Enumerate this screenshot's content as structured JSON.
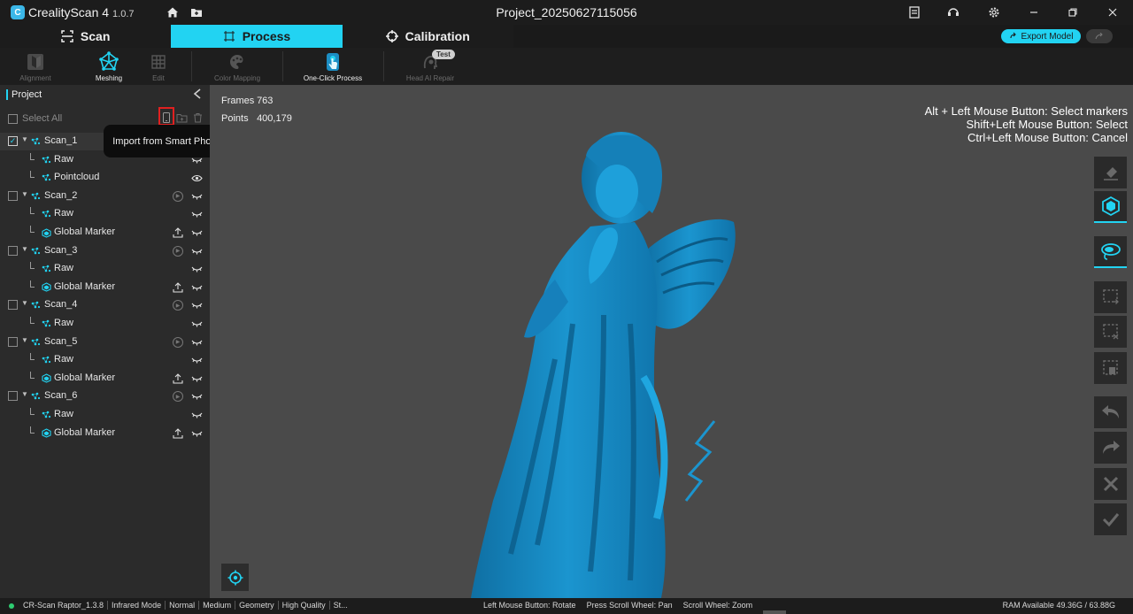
{
  "app": {
    "name": "CrealityScan 4",
    "version": "1.0.7",
    "project_title": "Project_20250627115056"
  },
  "titlebar_icons": [
    "home-icon",
    "folder-icon",
    "notes-icon",
    "support-icon",
    "settings-icon",
    "minimize-icon",
    "restore-icon",
    "close-icon"
  ],
  "modes": [
    {
      "label": "Scan",
      "icon": "scan-icon"
    },
    {
      "label": "Process",
      "icon": "process-icon",
      "active": true
    },
    {
      "label": "Calibration",
      "icon": "crosshair-icon"
    }
  ],
  "export": {
    "label": "Export Model"
  },
  "toolbar": {
    "tools": [
      {
        "label": "Alignment",
        "enabled": false
      },
      {
        "label": "Meshing",
        "enabled": true,
        "active": true
      },
      {
        "label": "Edit",
        "enabled": false
      },
      {
        "label": "Color Mapping",
        "enabled": false
      },
      {
        "label": "One-Click Process",
        "enabled": true
      },
      {
        "label": "Head AI Repair",
        "enabled": false
      }
    ],
    "badge": "Test"
  },
  "project": {
    "title": "Project",
    "select_all": "Select All",
    "tooltip": "Import from Smart Phone",
    "scans": [
      {
        "name": "Scan_1",
        "checked": true,
        "children": [
          "Raw",
          "Pointcloud"
        ]
      },
      {
        "name": "Scan_2",
        "checked": false,
        "children": [
          "Raw",
          "Global Marker"
        ]
      },
      {
        "name": "Scan_3",
        "checked": false,
        "children": [
          "Raw",
          "Global Marker"
        ]
      },
      {
        "name": "Scan_4",
        "checked": false,
        "children": [
          "Raw"
        ]
      },
      {
        "name": "Scan_5",
        "checked": false,
        "children": [
          "Raw",
          "Global Marker"
        ]
      },
      {
        "name": "Scan_6",
        "checked": false,
        "children": [
          "Raw",
          "Global Marker"
        ]
      }
    ]
  },
  "stats": {
    "frames_label": "Frames",
    "frames": "763",
    "points_label": "Points",
    "points": "400,179"
  },
  "hints": [
    "Alt + Left Mouse Button: Select markers",
    "Shift+Left Mouse Button: Select",
    "Ctrl+Left Mouse Button: Cancel"
  ],
  "statusbar": {
    "device": "CR-Scan Raptor_1.3.8",
    "items": [
      "Infrared Mode",
      "Normal",
      "Medium",
      "Geometry",
      "High Quality",
      "St..."
    ],
    "mouse": [
      "Left Mouse Button: Rotate",
      "Press Scroll Wheel: Pan",
      "Scroll Wheel: Zoom"
    ],
    "ram": "RAM Available 49.36G / 63.88G"
  },
  "colors": {
    "accent": "#22d3f2",
    "model": "#1a8fc7",
    "viewport": "#4a4a4a"
  }
}
